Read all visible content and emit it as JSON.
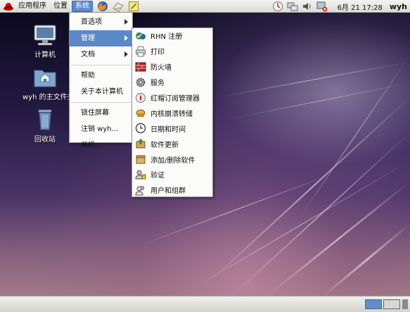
{
  "top_panel": {
    "applications_label": "应用程序",
    "places_label": "位置",
    "system_label": "系统",
    "clock": "6月 21 17:28",
    "user": "wyh",
    "launchers": [
      "firefox-icon",
      "mail-icon",
      "notes-icon"
    ],
    "tray": [
      "update-icon",
      "network-icon",
      "volume-icon",
      "alert-icon"
    ]
  },
  "desktop": {
    "icons": [
      {
        "label": "计算机",
        "icon": "computer-icon"
      },
      {
        "label": "wyh 的主文件夹",
        "icon": "home-folder-icon"
      },
      {
        "label": "回收站",
        "icon": "trash-icon"
      }
    ]
  },
  "system_menu": {
    "items": [
      {
        "label": "首选项",
        "submenu": true
      },
      {
        "label": "管理",
        "submenu": true,
        "highlighted": true
      },
      {
        "label": "文档",
        "submenu": true
      },
      {
        "label": "帮助"
      },
      {
        "label": "关于本计算机"
      },
      {
        "label": "锁住屏幕"
      },
      {
        "label": "注销 wyh..."
      },
      {
        "label": "关机..."
      }
    ]
  },
  "admin_menu": {
    "items": [
      {
        "label": "RHN 注册",
        "icon": "rhn-register-icon"
      },
      {
        "label": "打印",
        "icon": "printer-icon"
      },
      {
        "label": "防火墙",
        "icon": "firewall-icon"
      },
      {
        "label": "服务",
        "icon": "services-gear-icon"
      },
      {
        "label": "红帽订阅管理器",
        "icon": "subscription-manager-icon"
      },
      {
        "label": "内核崩溃转储",
        "icon": "kdump-icon"
      },
      {
        "label": "日期和时间",
        "icon": "clock-icon"
      },
      {
        "label": "软件更新",
        "icon": "software-update-icon"
      },
      {
        "label": "添加/删除软件",
        "icon": "add-remove-software-icon"
      },
      {
        "label": "验证",
        "icon": "authentication-icon"
      },
      {
        "label": "用户和组群",
        "icon": "users-groups-icon"
      }
    ]
  },
  "colors": {
    "menu_highlight": "#5b89c8",
    "panel_bg": "#e4e4e0",
    "desktop_dark": "#1c1430"
  }
}
